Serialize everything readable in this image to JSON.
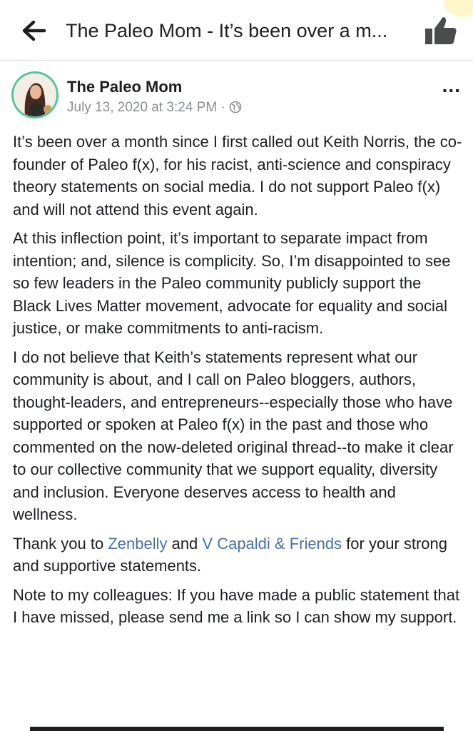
{
  "topbar": {
    "back_icon": "left-arrow-icon",
    "title": "The Paleo Mom - It’s been over a m...",
    "like_icon": "thumbs-up-icon"
  },
  "post": {
    "author": "The Paleo Mom",
    "timestamp": "July 13, 2020 at 3:24 PM",
    "separator": " · ",
    "privacy_icon": "globe-icon",
    "more_icon": "more-options-icon",
    "more_label": "...",
    "paragraphs": {
      "p1": "It’s been over a month since I first called out Keith Norris, the co-founder of Paleo f(x), for his racist, anti-science and conspiracy theory statements on social media. I do not support Paleo f(x) and will not attend this event again.",
      "p2": "At this inflection point, it’s important to separate impact from intention; and, silence is complicity. So, I’m disappointed to see so few leaders in the Paleo community publicly support the Black Lives Matter movement, advocate for equality and social justice, or make commitments to anti-racism.",
      "p3": "I do not believe that Keith’s statements represent what our community is about, and I call on Paleo bloggers, authors, thought-leaders, and entrepreneurs--especially those who have supported or spoken at Paleo f(x) in the past and those who commented on the now-deleted original thread--to make it clear to our collective community that we support equality, diversity and inclusion. Everyone deserves access to health and wellness.",
      "p4_start": "Thank you to ",
      "p4_link1": "Zenbelly",
      "p4_and": " and ",
      "p4_link2": "V Capaldi & Friends",
      "p4_end": " for your strong and supportive statements.",
      "p5": "Note to my colleagues: If you have made a public statement that I have missed, please send me a link so I can show my support."
    }
  },
  "colors": {
    "text": "#1c1e21",
    "meta": "#8a8d91",
    "link": "#4a6fa5",
    "avatar_ring": "#58c39c"
  }
}
